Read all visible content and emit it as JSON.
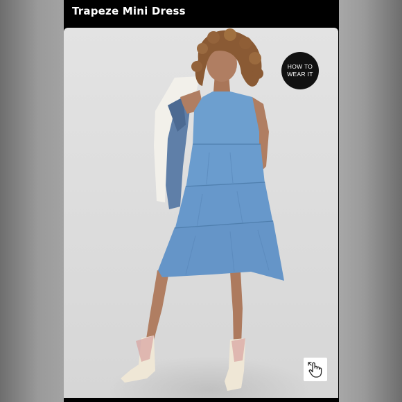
{
  "header": {
    "title": "Trapeze Mini Dress"
  },
  "badges": {
    "how_to_line1": "HOW TO",
    "how_to_line2": "WEAR IT"
  },
  "icons": {
    "zoom": "hand-pointer-zoom-icon"
  },
  "colors": {
    "dress": "#6a9fd0",
    "background": "#e0e0e0",
    "title_bar": "#000000"
  }
}
